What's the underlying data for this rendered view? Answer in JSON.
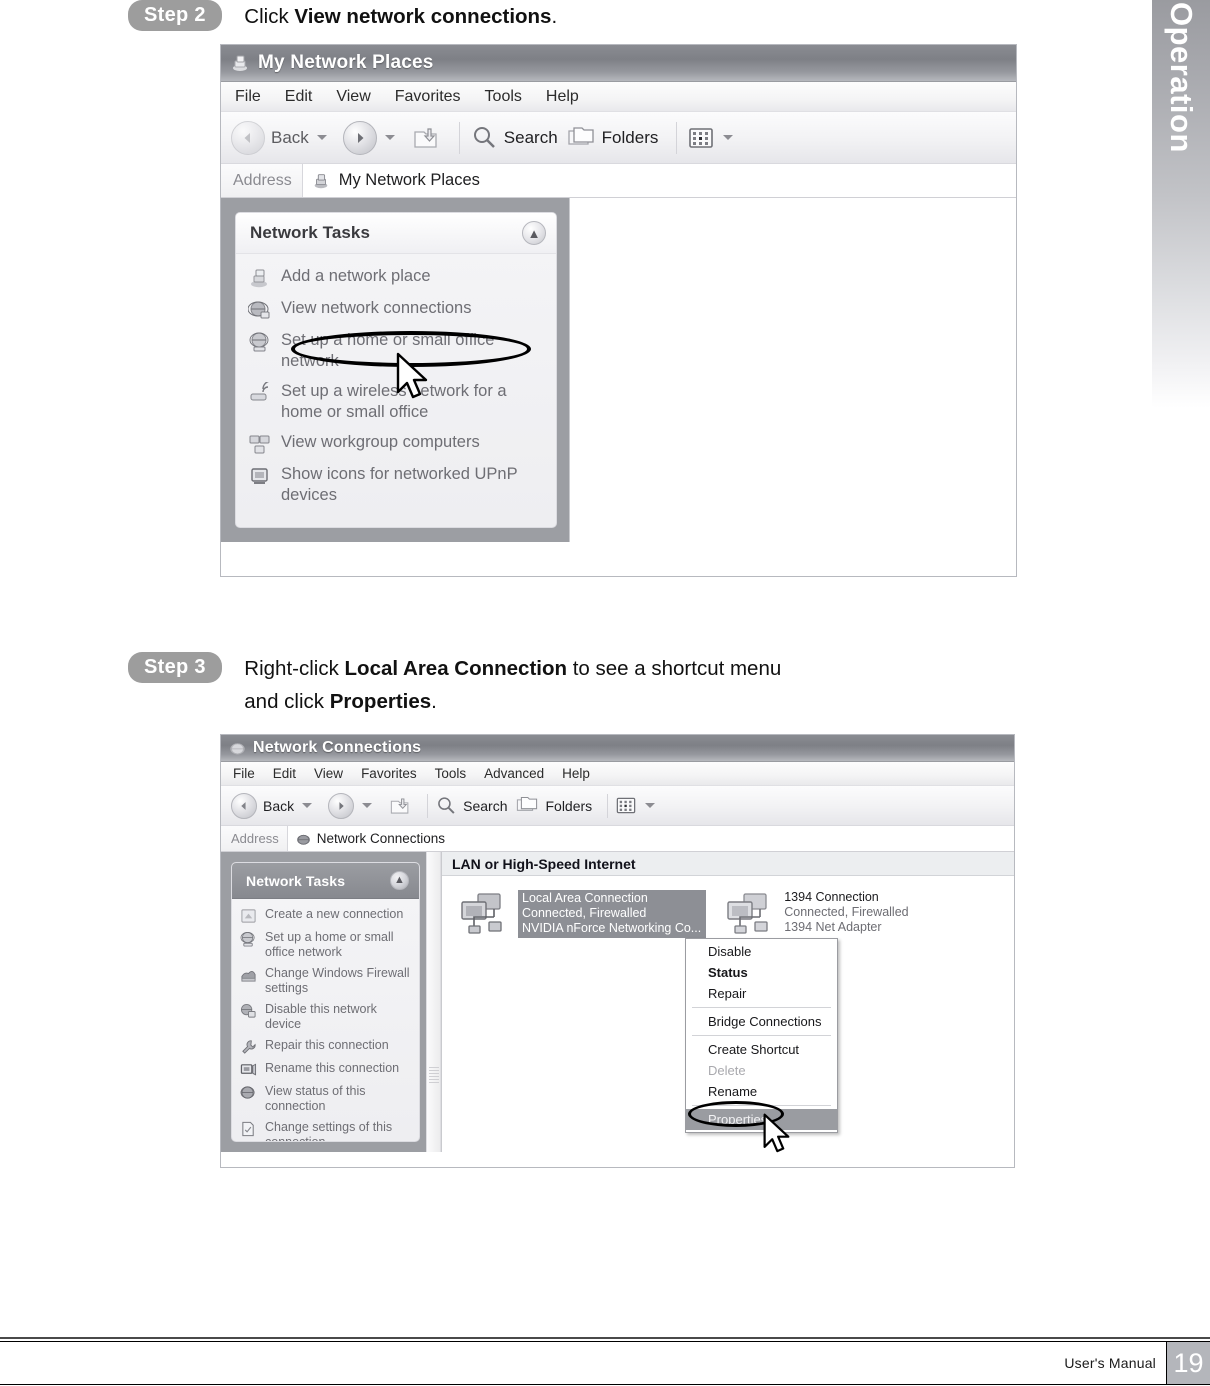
{
  "page": {
    "side_tab_label": "Operation",
    "footer_text": "User's Manual",
    "page_number": "19"
  },
  "step2": {
    "badge": "Step 2",
    "text_lead": "Click ",
    "text_bold": "View network connections",
    "text_tail": "."
  },
  "step3": {
    "badge": "Step 3",
    "line1_lead": "Right-click ",
    "line1_bold": "Local Area Connection",
    "line1_tail": " to see a shortcut menu",
    "line2_lead": "and click ",
    "line2_bold": "Properties",
    "line2_tail": "."
  },
  "window1": {
    "title": "My Network Places",
    "title_icon": "network-places-icon",
    "menu": [
      "File",
      "Edit",
      "View",
      "Favorites",
      "Tools",
      "Help"
    ],
    "toolbar": {
      "back": "Back",
      "search": "Search",
      "folders": "Folders",
      "views_icon": "views-grid-icon"
    },
    "address": {
      "label": "Address",
      "value": "My Network Places",
      "icon": "network-places-icon"
    },
    "tasks": {
      "title": "Network Tasks",
      "collapse_icon": "chevron-up-icon",
      "items": [
        {
          "label": "Add a network place",
          "icon": "add-network-place-icon"
        },
        {
          "label": "View network connections",
          "icon": "view-network-connections-icon"
        },
        {
          "label": "Set up a home or small office network",
          "icon": "home-network-icon"
        },
        {
          "label": "Set up a wireless network for a home or small office",
          "icon": "wireless-network-icon"
        },
        {
          "label": "View workgroup computers",
          "icon": "workgroup-computers-icon"
        },
        {
          "label": "Show icons for networked UPnP devices",
          "icon": "upnp-devices-icon"
        }
      ],
      "highlighted_index": 1
    }
  },
  "window2": {
    "title": "Network Connections",
    "title_icon": "network-connections-icon",
    "menu": [
      "File",
      "Edit",
      "View",
      "Favorites",
      "Tools",
      "Advanced",
      "Help"
    ],
    "toolbar": {
      "back": "Back",
      "search": "Search",
      "folders": "Folders",
      "views_icon": "views-grid-icon"
    },
    "address": {
      "label": "Address",
      "value": "Network Connections",
      "icon": "network-connections-icon"
    },
    "tasks": {
      "title": "Network Tasks",
      "collapse_icon": "chevron-up-icon",
      "items": [
        {
          "label": "Create a new connection",
          "icon": "create-connection-icon"
        },
        {
          "label": "Set up a home or small office network",
          "icon": "home-network-icon"
        },
        {
          "label": "Change Windows Firewall settings",
          "icon": "firewall-icon"
        },
        {
          "label": "Disable this network device",
          "icon": "disable-device-icon"
        },
        {
          "label": "Repair this connection",
          "icon": "repair-wrench-icon"
        },
        {
          "label": "Rename this connection",
          "icon": "rename-icon"
        },
        {
          "label": "View status of this connection",
          "icon": "view-status-icon"
        },
        {
          "label": "Change settings of this connection",
          "icon": "change-settings-icon"
        }
      ]
    },
    "group_header": "LAN or High-Speed Internet",
    "connections": [
      {
        "name": "Local Area Connection",
        "status": "Connected, Firewalled",
        "device": "NVIDIA nForce Networking Co...",
        "selected": true,
        "icon": "network-adapter-icon"
      },
      {
        "name": "1394 Connection",
        "status": "Connected, Firewalled",
        "device": "1394 Net Adapter",
        "selected": false,
        "icon": "network-adapter-icon"
      }
    ],
    "context_menu": {
      "items": [
        {
          "label": "Disable",
          "state": "normal"
        },
        {
          "label": "Status",
          "state": "bold"
        },
        {
          "label": "Repair",
          "state": "normal"
        },
        {
          "separator_after": true
        },
        {
          "label": "Bridge Connections",
          "state": "normal"
        },
        {
          "separator_after": true
        },
        {
          "label": "Create Shortcut",
          "state": "normal"
        },
        {
          "label": "Delete",
          "state": "disabled"
        },
        {
          "label": "Rename",
          "state": "normal"
        },
        {
          "separator_after": true
        },
        {
          "label": "Properties",
          "state": "highlight"
        }
      ]
    }
  },
  "colors": {
    "badge_gray": "#9d9d9d",
    "titlebar_gray": "#83858b",
    "selection_gray": "#8d8f95",
    "page_box_gray": "#b4b6bb",
    "annotation_black": "#000000"
  }
}
